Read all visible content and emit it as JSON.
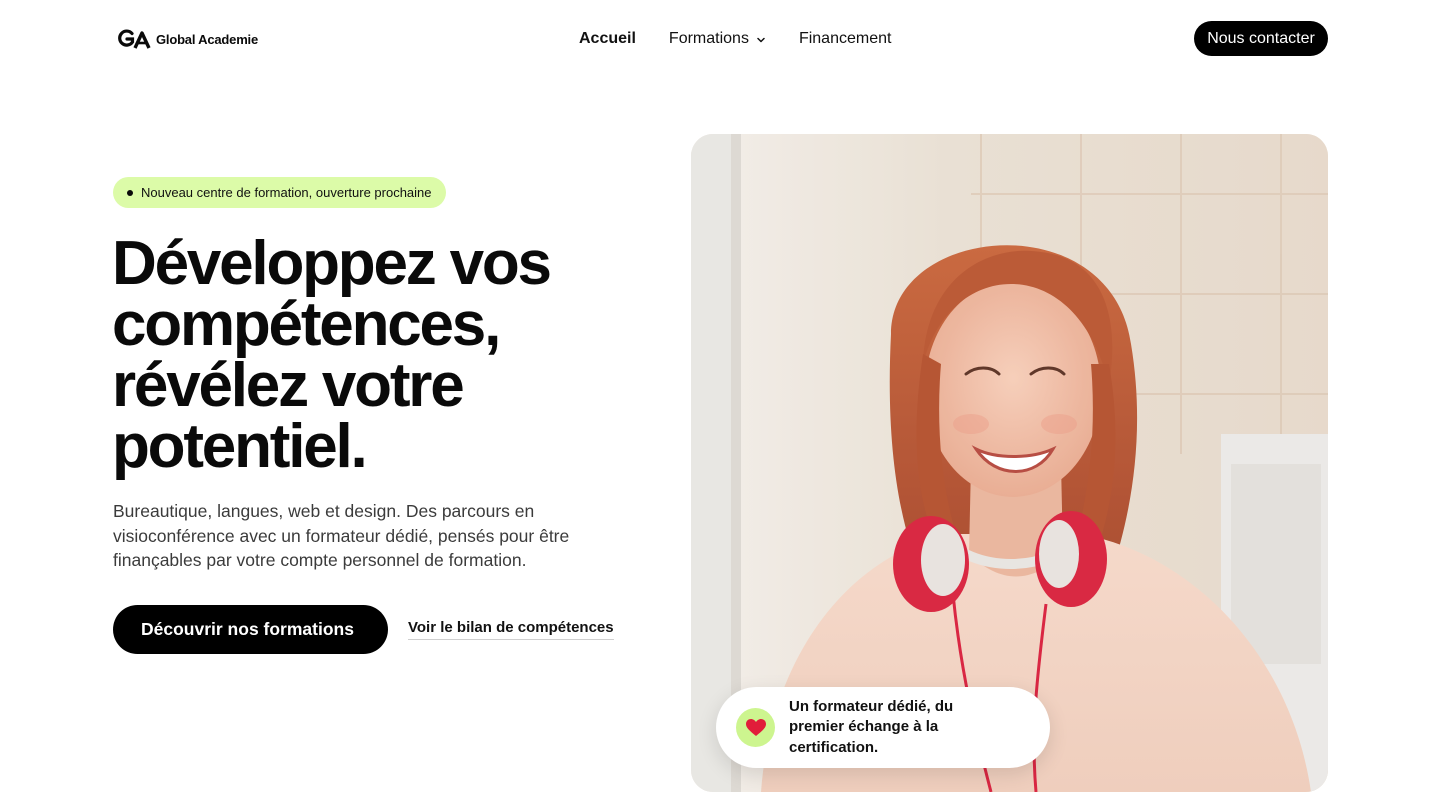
{
  "header": {
    "logo_text": "Global Academie",
    "logo_icon": "ga-logo-icon",
    "nav": [
      {
        "label": "Accueil",
        "active": true
      },
      {
        "label": "Formations",
        "has_dropdown": true,
        "icon": "chevron-down-icon"
      },
      {
        "label": "Financement"
      }
    ],
    "contact_label": "Nous contacter"
  },
  "hero": {
    "badge": "Nouveau centre de formation, ouverture prochaine",
    "title_lines": [
      "Développez vos",
      "compétences,",
      "révélez votre",
      "potentiel."
    ],
    "description": "Bureautique, langues, web et design. Des parcours en visioconférence avec un formateur dédié, pensés pour être finançables par votre compte personnel de formation.",
    "primary_cta": "Découvrir nos formations",
    "secondary_cta": "Voir le bilan de compétences"
  },
  "testimonial": {
    "icon": "heart-icon",
    "text": "Un formateur dédié, du premier échange à la certification."
  },
  "colors": {
    "accent_green": "#dcfba8",
    "badge_green": "#cdf58f",
    "heart_red": "#e11d3a",
    "button_black": "#000000"
  }
}
